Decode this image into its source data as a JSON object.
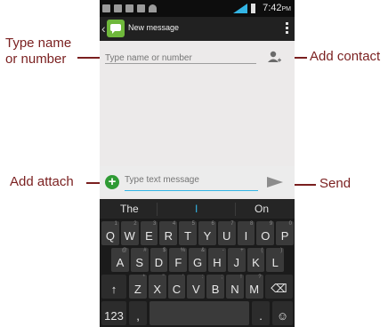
{
  "callouts": {
    "type_name_line1": "Type  name",
    "type_name_line2": "or number",
    "add_contact": "Add contact",
    "add_attach": "Add attach",
    "send": "Send"
  },
  "status_bar": {
    "time": "7:42",
    "ampm": "PM"
  },
  "action_bar": {
    "title": "New message"
  },
  "recipient": {
    "placeholder": "Type name or number"
  },
  "composer": {
    "placeholder": "Type text message"
  },
  "colors": {
    "accent": "#33b5e5",
    "callout": "#7a1f1f",
    "attach_green": "#2f9b35",
    "app_green": "#6fb83b"
  },
  "icons": [
    "back-chevron-icon",
    "message-app-icon",
    "overflow-menu-icon",
    "add-contact-icon",
    "add-attachment-icon",
    "send-icon",
    "shift-icon",
    "backspace-icon",
    "emoji-icon"
  ],
  "keyboard": {
    "suggestions": [
      "The",
      "I",
      "On"
    ],
    "row1": [
      {
        "key": "Q",
        "sub": "1"
      },
      {
        "key": "W",
        "sub": "2"
      },
      {
        "key": "E",
        "sub": "3"
      },
      {
        "key": "R",
        "sub": "4"
      },
      {
        "key": "T",
        "sub": "5"
      },
      {
        "key": "Y",
        "sub": "6"
      },
      {
        "key": "U",
        "sub": "7"
      },
      {
        "key": "I",
        "sub": "8"
      },
      {
        "key": "O",
        "sub": "9"
      },
      {
        "key": "P",
        "sub": "0"
      }
    ],
    "row2": [
      {
        "key": "A",
        "sub": "@"
      },
      {
        "key": "S",
        "sub": "#"
      },
      {
        "key": "D",
        "sub": "$"
      },
      {
        "key": "F",
        "sub": "%"
      },
      {
        "key": "G",
        "sub": "&"
      },
      {
        "key": "H",
        "sub": "-"
      },
      {
        "key": "J",
        "sub": "+"
      },
      {
        "key": "K",
        "sub": "("
      },
      {
        "key": "L",
        "sub": ")"
      }
    ],
    "row3": [
      {
        "key": "Z",
        "sub": "*"
      },
      {
        "key": "X",
        "sub": "\""
      },
      {
        "key": "C",
        "sub": "'"
      },
      {
        "key": "V",
        "sub": ":"
      },
      {
        "key": "B",
        "sub": ";"
      },
      {
        "key": "N",
        "sub": "!"
      },
      {
        "key": "M",
        "sub": "?"
      }
    ],
    "shift_label": "↑",
    "backspace_label": "⌫",
    "symbols_label": "123",
    "comma_label": ",",
    "period_label": ".",
    "emoji_label": "☺"
  }
}
